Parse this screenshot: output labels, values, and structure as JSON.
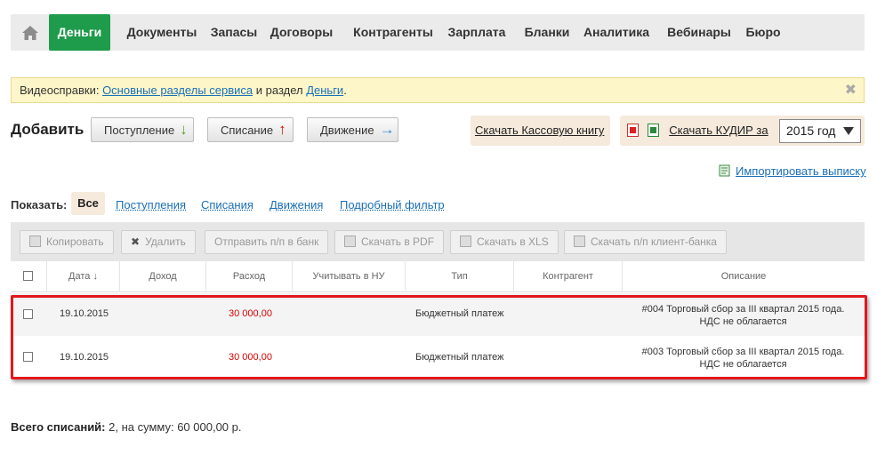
{
  "nav": {
    "items": [
      {
        "label": "Деньги",
        "active": true
      },
      {
        "label": "Документы"
      },
      {
        "label": "Запасы"
      },
      {
        "label": "Договоры"
      },
      {
        "label": "Контрагенты"
      },
      {
        "label": "Зарплата"
      },
      {
        "label": "Бланки"
      },
      {
        "label": "Аналитика"
      },
      {
        "label": "Вебинары"
      },
      {
        "label": "Бюро"
      }
    ],
    "active_color": "#1e9b4b"
  },
  "infobar": {
    "prefix": "Видеосправки: ",
    "link1": "Основные разделы сервиса",
    "middle": " и раздел ",
    "link2": "Деньги",
    "suffix": ".",
    "close": "✖"
  },
  "add": {
    "label": "Добавить",
    "income": {
      "label": "Поступление",
      "arrow": "↓"
    },
    "expense": {
      "label": "Списание",
      "arrow": "↑"
    },
    "movement": {
      "label": "Движение",
      "arrow": "→"
    }
  },
  "downloads": {
    "cashbook": "Скачать Кассовую книгу",
    "kudir": "Скачать КУДИР за",
    "year": "2015 год"
  },
  "import_label": "Импортировать выписку",
  "filter": {
    "label": "Показать:",
    "items": [
      "Все",
      "Поступления",
      "Списания",
      "Движения",
      "Подробный фильтр"
    ]
  },
  "toolbar": {
    "copy": "Копировать",
    "delete": "Удалить",
    "send": "Отправить п/п в банк",
    "pdf": "Скачать в PDF",
    "xls": "Скачать в XLS",
    "client_bank": "Скачать п/п клиент-банка"
  },
  "table": {
    "headers": {
      "date": "Дата ↓",
      "income": "Доход",
      "expense": "Расход",
      "tax": "Учитывать в НУ",
      "type": "Тип",
      "counterparty": "Контрагент",
      "description": "Описание"
    },
    "rows": [
      {
        "date": "19.10.2015",
        "expense": "30 000,00",
        "type": "Бюджетный платеж",
        "desc_line1": "#004 Торговый сбор за III квартал 2015 года.",
        "desc_line2": "НДС не облагается"
      },
      {
        "date": "19.10.2015",
        "expense": "30 000,00",
        "type": "Бюджетный платеж",
        "desc_line1": "#003 Торговый сбор за III квартал 2015 года.",
        "desc_line2": "НДС не облагается"
      }
    ]
  },
  "total": {
    "label": "Всего списаний:",
    "text": " 2, на сумму: 60 000,00 р."
  },
  "colors": {
    "link": "#1a6fb7",
    "amount": "#d40000",
    "highlight": "#e2181c"
  }
}
